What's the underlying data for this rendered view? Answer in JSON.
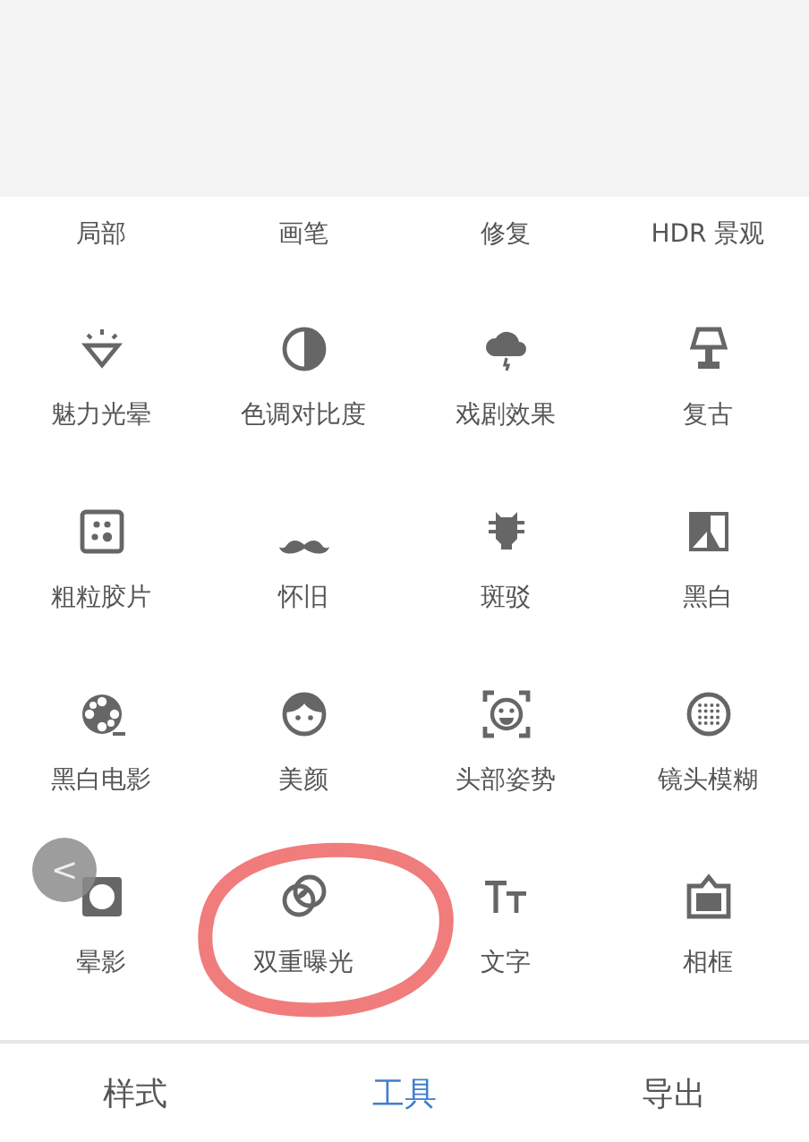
{
  "tool_rows": [
    [
      {
        "label": "局部",
        "kind": "cut"
      },
      {
        "label": "画笔",
        "kind": "cut"
      },
      {
        "label": "修复",
        "kind": "cut"
      },
      {
        "label": "HDR 景观",
        "kind": "cut"
      }
    ],
    [
      {
        "label": "魅力光晕",
        "kind": "tool"
      },
      {
        "label": "色调对比度",
        "kind": "tool"
      },
      {
        "label": "戏剧效果",
        "kind": "tool"
      },
      {
        "label": "复古",
        "kind": "tool"
      }
    ],
    [
      {
        "label": "粗粒胶片",
        "kind": "tool"
      },
      {
        "label": "怀旧",
        "kind": "tool"
      },
      {
        "label": "斑驳",
        "kind": "tool"
      },
      {
        "label": "黑白",
        "kind": "tool"
      }
    ],
    [
      {
        "label": "黑白电影",
        "kind": "tool"
      },
      {
        "label": "美颜",
        "kind": "tool"
      },
      {
        "label": "头部姿势",
        "kind": "tool"
      },
      {
        "label": "镜头模糊",
        "kind": "tool"
      }
    ],
    [
      {
        "label": "晕影",
        "kind": "tool"
      },
      {
        "label": "双重曝光",
        "kind": "tool",
        "annotated": true
      },
      {
        "label": "文字",
        "kind": "tool"
      },
      {
        "label": "相框",
        "kind": "tool"
      }
    ]
  ],
  "back_button": {
    "glyph": "<"
  },
  "tabs": [
    {
      "label": "样式",
      "selected": false
    },
    {
      "label": "工具",
      "selected": true
    },
    {
      "label": "导出",
      "selected": false
    }
  ]
}
